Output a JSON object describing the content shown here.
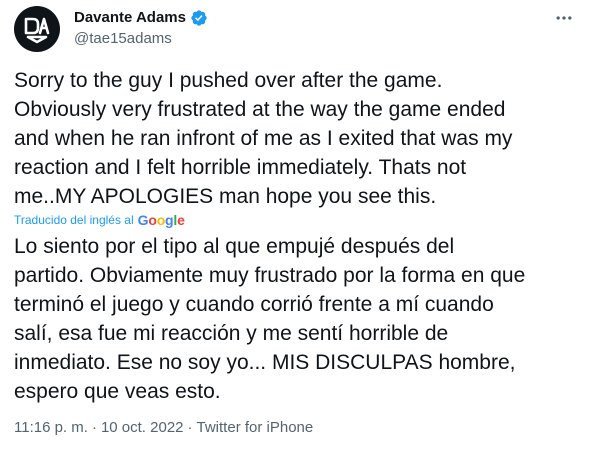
{
  "author": {
    "display_name": "Davante Adams",
    "handle": "@tae15adams",
    "avatar_icon": "logo-avatar-icon",
    "verified_icon": "verified-badge-icon",
    "verified_color": "#1d9bf0"
  },
  "more_icon": "more-options-icon",
  "tweet": {
    "text": "Sorry to the guy I pushed over after the game.\nObviously very frustrated at the way the game ended\nand when he ran infront of me as I exited that was my\nreaction and I felt horrible immediately. Thats not\nme..MY APOLOGIES man hope you see this."
  },
  "translation": {
    "label": "Traducido del inglés al",
    "provider": [
      "G",
      "o",
      "o",
      "g",
      "l",
      "e"
    ],
    "text": "Lo siento por el tipo al que empujé después del\npartido. Obviamente muy frustrado por la forma en que\nterminó el juego y cuando corrió frente a mí cuando\nsalí, esa fue mi reacción y me sentí horrible de\ninmediato. Ese no soy yo... MIS DISCULPAS hombre,\nespero que veas esto."
  },
  "meta": {
    "time": "11:16 p. m.",
    "separator1": "·",
    "date": "10 oct. 2022",
    "separator2": "·",
    "source": "Twitter for iPhone"
  },
  "colors": {
    "text": "#0f1419",
    "secondary": "#536471",
    "accent": "#1d9bf0"
  }
}
